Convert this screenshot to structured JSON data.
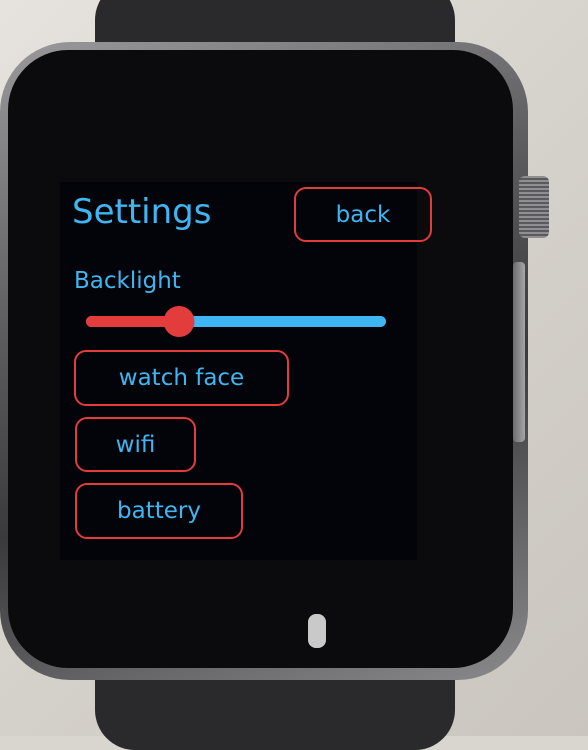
{
  "header": {
    "title": "Settings",
    "back_label": "back"
  },
  "backlight": {
    "label": "Backlight",
    "level_fraction": 0.31
  },
  "menu": {
    "items": [
      {
        "label": "watch face"
      },
      {
        "label": "wifi"
      },
      {
        "label": "battery"
      }
    ]
  },
  "colors": {
    "accent_blue": "#3fb6f2",
    "accent_red": "#e23c3c",
    "screen_bg": "#02040a"
  },
  "icons": {
    "microphone": "microphone-icon"
  }
}
